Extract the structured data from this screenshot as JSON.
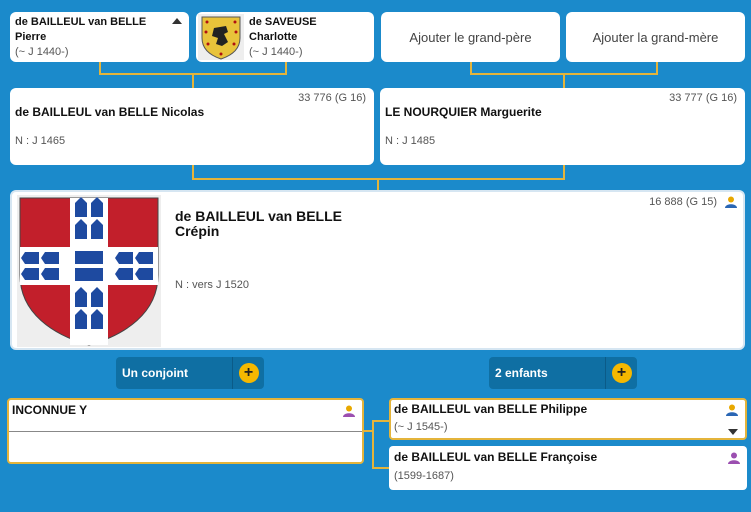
{
  "grandparents": {
    "pierre": {
      "surname": "de BAILLEUL van BELLE",
      "firstname": "Pierre",
      "dates": "(~ J 1440-)"
    },
    "charlotte": {
      "surname": "de SAVEUSE",
      "firstname": "Charlotte",
      "dates": "(~ J 1440-)"
    },
    "add_grandfather": "Ajouter le grand-père",
    "add_grandmother": "Ajouter la grand-mère"
  },
  "parents": {
    "father": {
      "name": "de BAILLEUL van BELLE Nicolas",
      "number": "33 776 (G 16)",
      "birth": "N : J 1465"
    },
    "mother": {
      "name": "LE NOURQUIER Marguerite",
      "number": "33 777 (G 16)",
      "birth": "N : J 1485"
    }
  },
  "main": {
    "surname": "de BAILLEUL van BELLE",
    "firstname": "Crépin",
    "number": "16 888 (G 15)",
    "birth": "N : vers J 1520"
  },
  "spouse_button": "Un conjoint",
  "children_button": "2 enfants",
  "spouse": {
    "name": "INCONNUE Y"
  },
  "children": [
    {
      "name": "de BAILLEUL van BELLE Philippe",
      "dates": "(~ J 1545-)"
    },
    {
      "name": "de BAILLEUL van BELLE Françoise",
      "dates": "(1599-1687)"
    }
  ],
  "colors": {
    "background": "#1b8acb",
    "connector": "#e4b43b",
    "male": "#e8a800",
    "female": "#9b4fb0",
    "plus": "#f5b800"
  }
}
